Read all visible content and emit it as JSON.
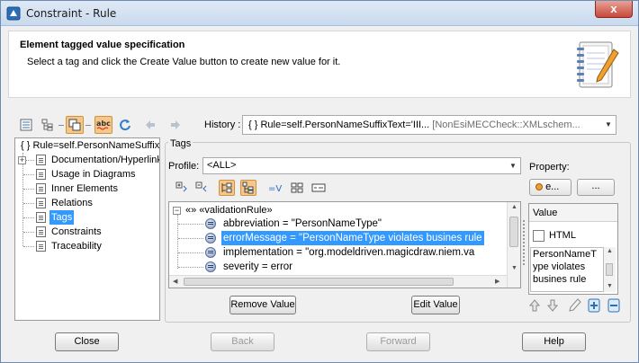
{
  "window": {
    "title": "Constraint - Rule",
    "close_glyph": "x"
  },
  "header": {
    "title": "Element tagged value specification",
    "description": "Select a tag and click the Create Value button to create new value for it."
  },
  "toolbar": {
    "history_label": "History :",
    "history_value": "{ }  Rule=self.PersonNameSuffixText='III...",
    "history_context": "[NonEsiMECCheck::XMLschem..."
  },
  "tree": {
    "root_label": "{ }  Rule=self.PersonNameSuffix",
    "items": [
      {
        "label": "Documentation/Hyperlink",
        "expandable": true
      },
      {
        "label": "Usage in Diagrams"
      },
      {
        "label": "Inner Elements"
      },
      {
        "label": "Relations"
      },
      {
        "label": "Tags",
        "selected": true
      },
      {
        "label": "Constraints"
      },
      {
        "label": "Traceability"
      }
    ]
  },
  "tags": {
    "group_label": "Tags",
    "profile_label": "Profile:",
    "profile_value": "<ALL>",
    "property_label": "Property:",
    "property_btn": "e...",
    "property_more": "...",
    "stereotype": "«»  «validationRule»",
    "rows": [
      {
        "text": "abbreviation = \"PersonNameType\""
      },
      {
        "text": "errorMessage = \"PersonNameType violates busines rule",
        "selected": true
      },
      {
        "text": "implementation = \"org.modeldriven.magicdraw.niem.va"
      },
      {
        "text": "severity = error"
      }
    ],
    "remove_value": "Remove Value",
    "edit_value": "Edit Value"
  },
  "value_panel": {
    "header": "Value",
    "html_label": "HTML",
    "html_checked": false,
    "lines": [
      "PersonNameT",
      "ype violates",
      "busines rule"
    ]
  },
  "footer": {
    "close": "Close",
    "back": "Back",
    "forward": "Forward",
    "help": "Help"
  },
  "colors": {
    "selection": "#3399ff",
    "toolbar_toggle": "#f6c788"
  }
}
